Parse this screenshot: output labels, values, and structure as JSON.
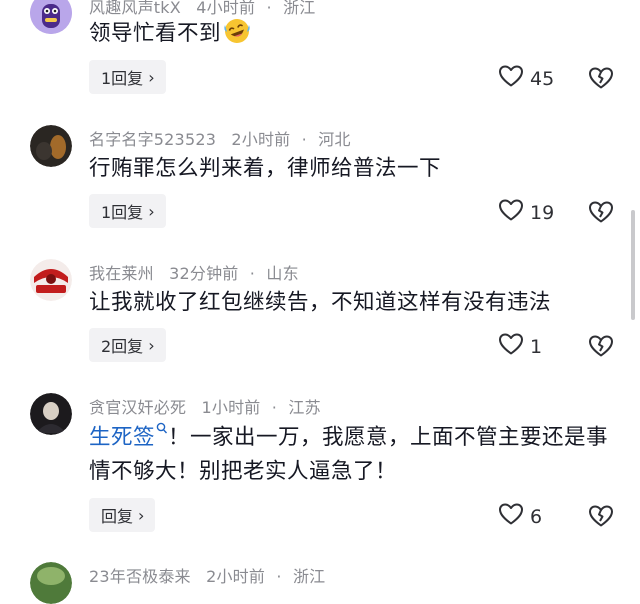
{
  "comments": [
    {
      "user": "风趣风声tkX",
      "time": "4小时前",
      "location": "浙江",
      "text": "领导忙看不到",
      "emoji": "laughing-crying-emoji",
      "reply_label": "1回复",
      "likes": "45"
    },
    {
      "user": "名字名字523523",
      "time": "2小时前",
      "location": "河北",
      "text": "行贿罪怎么判来着，律师给普法一下",
      "reply_label": "1回复",
      "likes": "19"
    },
    {
      "user": "我在莱州",
      "time": "32分钟前",
      "location": "山东",
      "text": "让我就收了红包继续告，不知道这样有没有违法",
      "reply_label": "2回复",
      "likes": "1"
    },
    {
      "user": "贪官汉奸必死",
      "time": "1小时前",
      "location": "江苏",
      "mention": "生死签",
      "text": "！一家出一万，我愿意，上面不管主要还是事情不够大！别把老实人逼急了！",
      "reply_label": "回复",
      "likes": "6"
    },
    {
      "user": "23年否极泰来",
      "time": "2小时前",
      "location": "浙江"
    }
  ],
  "icons": {
    "like": "heart-outline-icon",
    "dislike": "broken-heart-icon",
    "reply_chevron": "chevron-right-icon",
    "mention": "search-icon"
  },
  "colors": {
    "meta": "#8a8b91",
    "mention": "#1d64c4",
    "reply_bg": "#f2f2f4"
  }
}
